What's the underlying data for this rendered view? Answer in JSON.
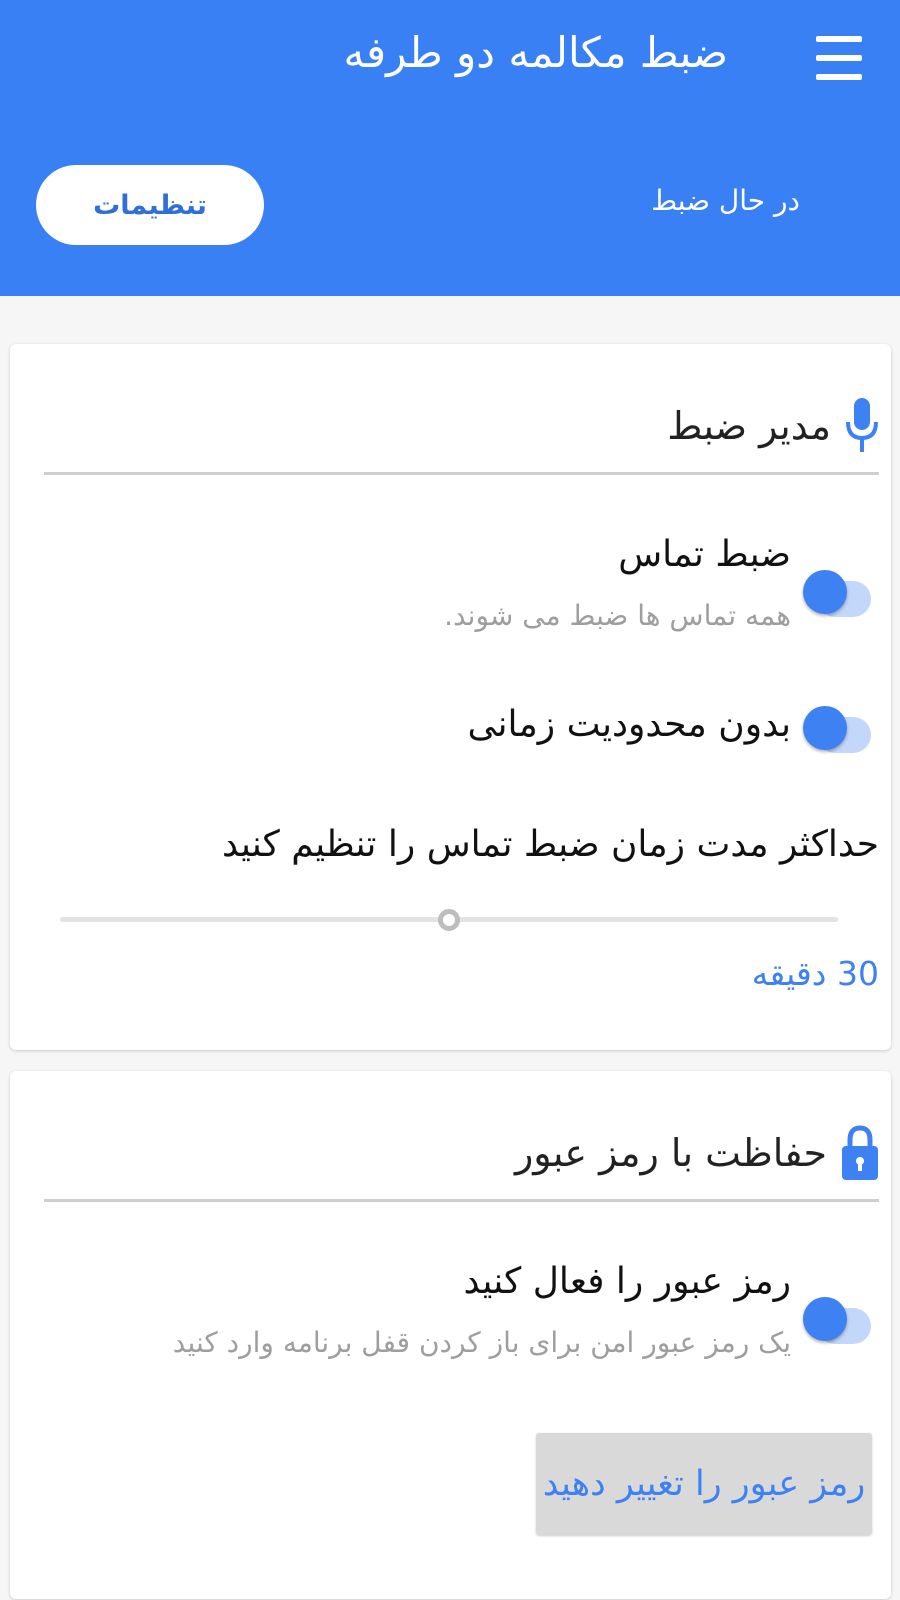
{
  "colors": {
    "primary": "#3a80f5",
    "accent": "#3e81f2",
    "background": "#f6f6f6",
    "card": "#ffffff"
  },
  "appbar": {
    "title": "ضبط مکالمه دو طرفه",
    "menu_icon": "hamburger-menu-icon",
    "tabs": [
      {
        "label": "در حال ضبط",
        "selected": false
      },
      {
        "label": "تنظیمات",
        "selected": true
      }
    ]
  },
  "recording_manager": {
    "icon": "microphone-icon",
    "title": "مدیر ضبط",
    "call_recording": {
      "title": "ضبط تماس",
      "subtitle": "همه تماس ها ضبط می شوند.",
      "enabled": true
    },
    "no_time_limit": {
      "title": "بدون محدودیت زمانی",
      "enabled": true
    },
    "max_duration": {
      "label": "حداکثر مدت زمان ضبط تماس را تنظیم کنید",
      "value_text": "30 دقیقه",
      "position_fraction": 0.5
    }
  },
  "password_protection": {
    "icon": "lock-icon",
    "title": "حفاظت با رمز عبور",
    "enable_password": {
      "title": "رمز عبور را فعال کنید",
      "subtitle": "یک رمز عبور امن برای باز کردن قفل برنامه وارد کنید",
      "enabled": true
    },
    "change_button_label": "رمز عبور را تغییر دهید"
  }
}
